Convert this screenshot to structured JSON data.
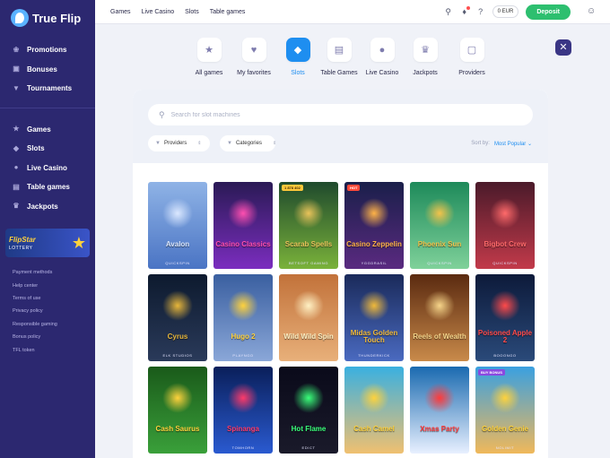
{
  "brand": {
    "name": "True Flip"
  },
  "sidebar": {
    "primary": [
      {
        "label": "Promotions",
        "icon": "promotions-icon"
      },
      {
        "label": "Bonuses",
        "icon": "gift-icon"
      },
      {
        "label": "Tournaments",
        "icon": "trophy-icon"
      }
    ],
    "secondary": [
      {
        "label": "Games",
        "icon": "games-icon"
      },
      {
        "label": "Slots",
        "icon": "diamond-icon"
      },
      {
        "label": "Live Casino",
        "icon": "person-icon"
      },
      {
        "label": "Table games",
        "icon": "cards-icon"
      },
      {
        "label": "Jackpots",
        "icon": "crown-icon"
      }
    ],
    "lottery": {
      "brand": "FlipStar",
      "label": "LOTTERY"
    },
    "footer_links": [
      "Payment methods",
      "Help center",
      "Terms of use",
      "Privacy policy",
      "Responsible gaming",
      "Bonus policy",
      "TFL token"
    ]
  },
  "topbar": {
    "nav": [
      "Games",
      "Live Casino",
      "Slots",
      "Table games"
    ],
    "balance": "0 EUR",
    "deposit_label": "Deposit"
  },
  "categories": [
    {
      "label": "All games",
      "icon": "star-icon",
      "active": false
    },
    {
      "label": "My favorites",
      "icon": "heart-icon",
      "active": false
    },
    {
      "label": "Slots",
      "icon": "diamond-icon",
      "active": true
    },
    {
      "label": "Table Games",
      "icon": "cards-icon",
      "active": false
    },
    {
      "label": "Live Casino",
      "icon": "person-icon",
      "active": false
    },
    {
      "label": "Jackpots",
      "icon": "crown-icon",
      "active": false
    },
    {
      "label": "Providers",
      "icon": "box-icon",
      "active": false
    }
  ],
  "search": {
    "placeholder": "Search for slot machines",
    "value": ""
  },
  "filters": {
    "providers": "Providers",
    "categories": "Categories"
  },
  "sort": {
    "label": "Sort by:",
    "value": "Most Popular"
  },
  "games": [
    {
      "title": "Avalon",
      "provider": "QUICKSPIN",
      "badge": "",
      "bg": [
        "#8fb3e6",
        "#4a74c4"
      ],
      "accent": "#dbe8ff"
    },
    {
      "title": "Casino Classics",
      "provider": "",
      "badge": "",
      "bg": [
        "#2a1a55",
        "#7b2dbf"
      ],
      "accent": "#ff4fb0"
    },
    {
      "title": "Scarab Spells",
      "provider": "BETSOFT GAMING",
      "badge": "1 878 402",
      "bg": [
        "#1f4a2d",
        "#7ab23a"
      ],
      "accent": "#e9c35a"
    },
    {
      "title": "Casino Zeppelin",
      "provider": "YGGDRASIL",
      "badge": "HOT",
      "bg": [
        "#1a1f4a",
        "#5a2a80"
      ],
      "accent": "#ffb347"
    },
    {
      "title": "Phoenix Sun",
      "provider": "QUICKSPIN",
      "badge": "",
      "bg": [
        "#1d8a5a",
        "#7fd19a"
      ],
      "accent": "#f3c34a"
    },
    {
      "title": "Bigbot Crew",
      "provider": "QUICKSPIN",
      "badge": "",
      "bg": [
        "#4a1a2a",
        "#c23a4a"
      ],
      "accent": "#ff6a6a"
    },
    {
      "title": "Cyrus",
      "provider": "ELK STUDIOS",
      "badge": "",
      "bg": [
        "#0d1a2e",
        "#2a3a5a"
      ],
      "accent": "#e7b63a"
    },
    {
      "title": "Hugo 2",
      "provider": "PLAYNGO",
      "badge": "",
      "bg": [
        "#3a5fa0",
        "#8aa7d8"
      ],
      "accent": "#ffd23c"
    },
    {
      "title": "Wild Wild Spin",
      "provider": "",
      "badge": "",
      "bg": [
        "#c2723a",
        "#e8b07a"
      ],
      "accent": "#fff1c4"
    },
    {
      "title": "Midas Golden Touch",
      "provider": "THUNDERKICK",
      "badge": "",
      "bg": [
        "#1a2a5a",
        "#4a6ac0"
      ],
      "accent": "#f0b93a"
    },
    {
      "title": "Reels of Wealth",
      "provider": "",
      "badge": "",
      "bg": [
        "#5a2a10",
        "#c98a4a"
      ],
      "accent": "#f6d58a"
    },
    {
      "title": "Poisoned Apple 2",
      "provider": "BOOONGO",
      "badge": "",
      "bg": [
        "#0d1a3a",
        "#2a4a7a"
      ],
      "accent": "#ff4a4a"
    },
    {
      "title": "Cash Saurus",
      "provider": "",
      "badge": "",
      "bg": [
        "#1a5a1a",
        "#3aa03a"
      ],
      "accent": "#ffd23c"
    },
    {
      "title": "Spinanga",
      "provider": "TOMHORN",
      "badge": "",
      "bg": [
        "#0a1f5a",
        "#2a5ad0"
      ],
      "accent": "#ff3a6a"
    },
    {
      "title": "Hot Flame",
      "provider": "EDICT",
      "badge": "",
      "bg": [
        "#0a0a1a",
        "#1a1a2a"
      ],
      "accent": "#3aff7a"
    },
    {
      "title": "Cash Camel",
      "provider": "",
      "badge": "",
      "bg": [
        "#3ab0e0",
        "#f0c070"
      ],
      "accent": "#ffd23c"
    },
    {
      "title": "Xmas Party",
      "provider": "",
      "badge": "",
      "bg": [
        "#1a6ab0",
        "#e8f0ff"
      ],
      "accent": "#ff3a3a"
    },
    {
      "title": "Golden Genie",
      "provider": "NOLIMIT",
      "badge": "BUY BONUS",
      "bg": [
        "#3aa0e0",
        "#f0b85a"
      ],
      "accent": "#ffd23c"
    }
  ]
}
